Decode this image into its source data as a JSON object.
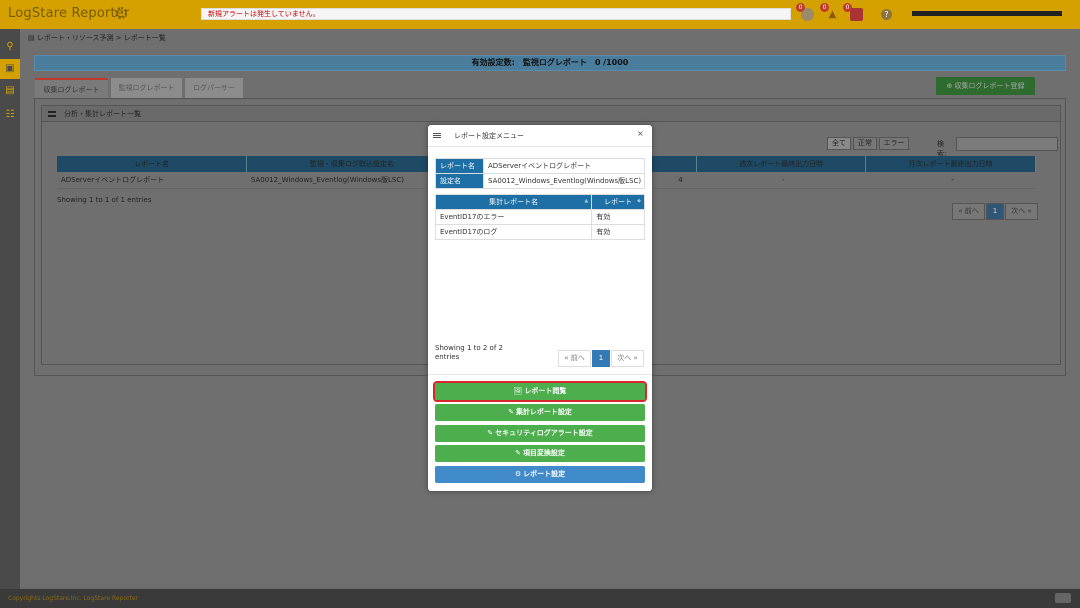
{
  "header": {
    "app_title": "LogStare Reporter",
    "alert_message": "新規アラートは発生していません。",
    "badges": [
      "0",
      "0",
      "0"
    ],
    "help": "?"
  },
  "nav": {
    "icons": [
      "search-icon",
      "report-icon",
      "book-icon",
      "users-icon"
    ]
  },
  "breadcrumb": "レポート・リソース予測 > レポート一覧",
  "summary": "有効設定数:　監視ログレポート　0 /1000",
  "tabs": [
    "収集ログレポート",
    "監視ログレポート",
    "ログパーサー"
  ],
  "register_button": "⊕ 収集ログレポート登録",
  "panel": {
    "title": "分析・集計レポート一覧",
    "filters": [
      "全て",
      "正常",
      "エラー"
    ],
    "search_label": "検索:",
    "columns": [
      "レポート名",
      "監視・収集ログ取込設定名",
      "",
      "週次レポート最終出力日時",
      "月次レポート最終出力日時"
    ],
    "rows": [
      {
        "name": "ADServerイベントログレポート",
        "setting": "SA0012_Windows_Eventlog(Windows版LSC)",
        "col3": "4",
        "weekly": "-",
        "monthly": "-"
      }
    ],
    "entries": "Showing 1 to 1 of 1 entries",
    "pager": {
      "prev": "« 前へ",
      "page": "1",
      "next": "次へ »"
    }
  },
  "modal": {
    "title": "レポート設定メニュー",
    "close": "×",
    "info": [
      {
        "key": "レポート名",
        "value": "ADServerイベントログレポート"
      },
      {
        "key": "設定名",
        "value": "SA0012_Windows_Eventlog(Windows版LSC)"
      }
    ],
    "sub_columns": [
      "集計レポート名",
      "レポート"
    ],
    "sub_rows": [
      {
        "name": "EventID17のエラー",
        "status": "有効"
      },
      {
        "name": "EventID17のログ",
        "status": "有効"
      }
    ],
    "entries": "Showing 1 to 2 of 2 entries",
    "pager": {
      "prev": "« 前へ",
      "page": "1",
      "next": "次へ »"
    },
    "buttons": [
      {
        "icon": "🖼",
        "label": "レポート閲覧",
        "color": "green",
        "highlight": true
      },
      {
        "icon": "✎",
        "label": "集計レポート設定",
        "color": "green"
      },
      {
        "icon": "✎",
        "label": "セキュリティログアラート設定",
        "color": "green"
      },
      {
        "icon": "✎",
        "label": "項目変換設定",
        "color": "green"
      },
      {
        "icon": "⚙",
        "label": "レポート設定",
        "color": "blue"
      }
    ]
  },
  "footer": "Copyrights LogStare,Inc.  LogStare Reporter",
  "colors": {
    "header": "#d4a100",
    "primary": "#337ab7",
    "success": "#4cae4c",
    "highlight": "#d9262c"
  }
}
